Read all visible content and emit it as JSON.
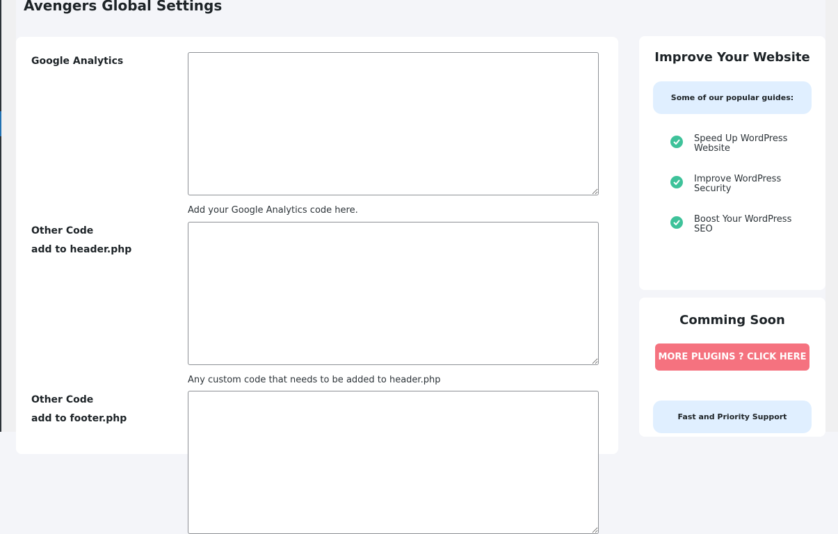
{
  "page": {
    "title": "Avengers Global Settings"
  },
  "fields": [
    {
      "label_line1": "Google Analytics",
      "label_line2": "",
      "value": "",
      "help": "Add your Google Analytics code here."
    },
    {
      "label_line1": "Other Code",
      "label_line2": "add to header.php",
      "value": "",
      "help": "Any custom code that needs to be added to header.php"
    },
    {
      "label_line1": "Other Code",
      "label_line2": "add to footer.php",
      "value": "",
      "help": ""
    }
  ],
  "sidebar": {
    "improve": {
      "title": "Improve Your Website",
      "pill": "Some of our popular guides:",
      "guides": [
        {
          "label": "Speed Up WordPress Website",
          "icon": "check-circle-icon"
        },
        {
          "label": "Improve WordPress Security",
          "icon": "check-circle-icon"
        },
        {
          "label": "Boost Your WordPress SEO",
          "icon": "check-circle-icon"
        }
      ]
    },
    "coming": {
      "title": "Comming Soon",
      "button": "MORE PLUGINS ? CLICK HERE",
      "support": "Fast and Priority Support"
    }
  },
  "colors": {
    "background": "#f4f5f9",
    "card": "#ffffff",
    "pill": "#e0efff",
    "check": "#3ec29a",
    "cta": "#f5727f"
  }
}
